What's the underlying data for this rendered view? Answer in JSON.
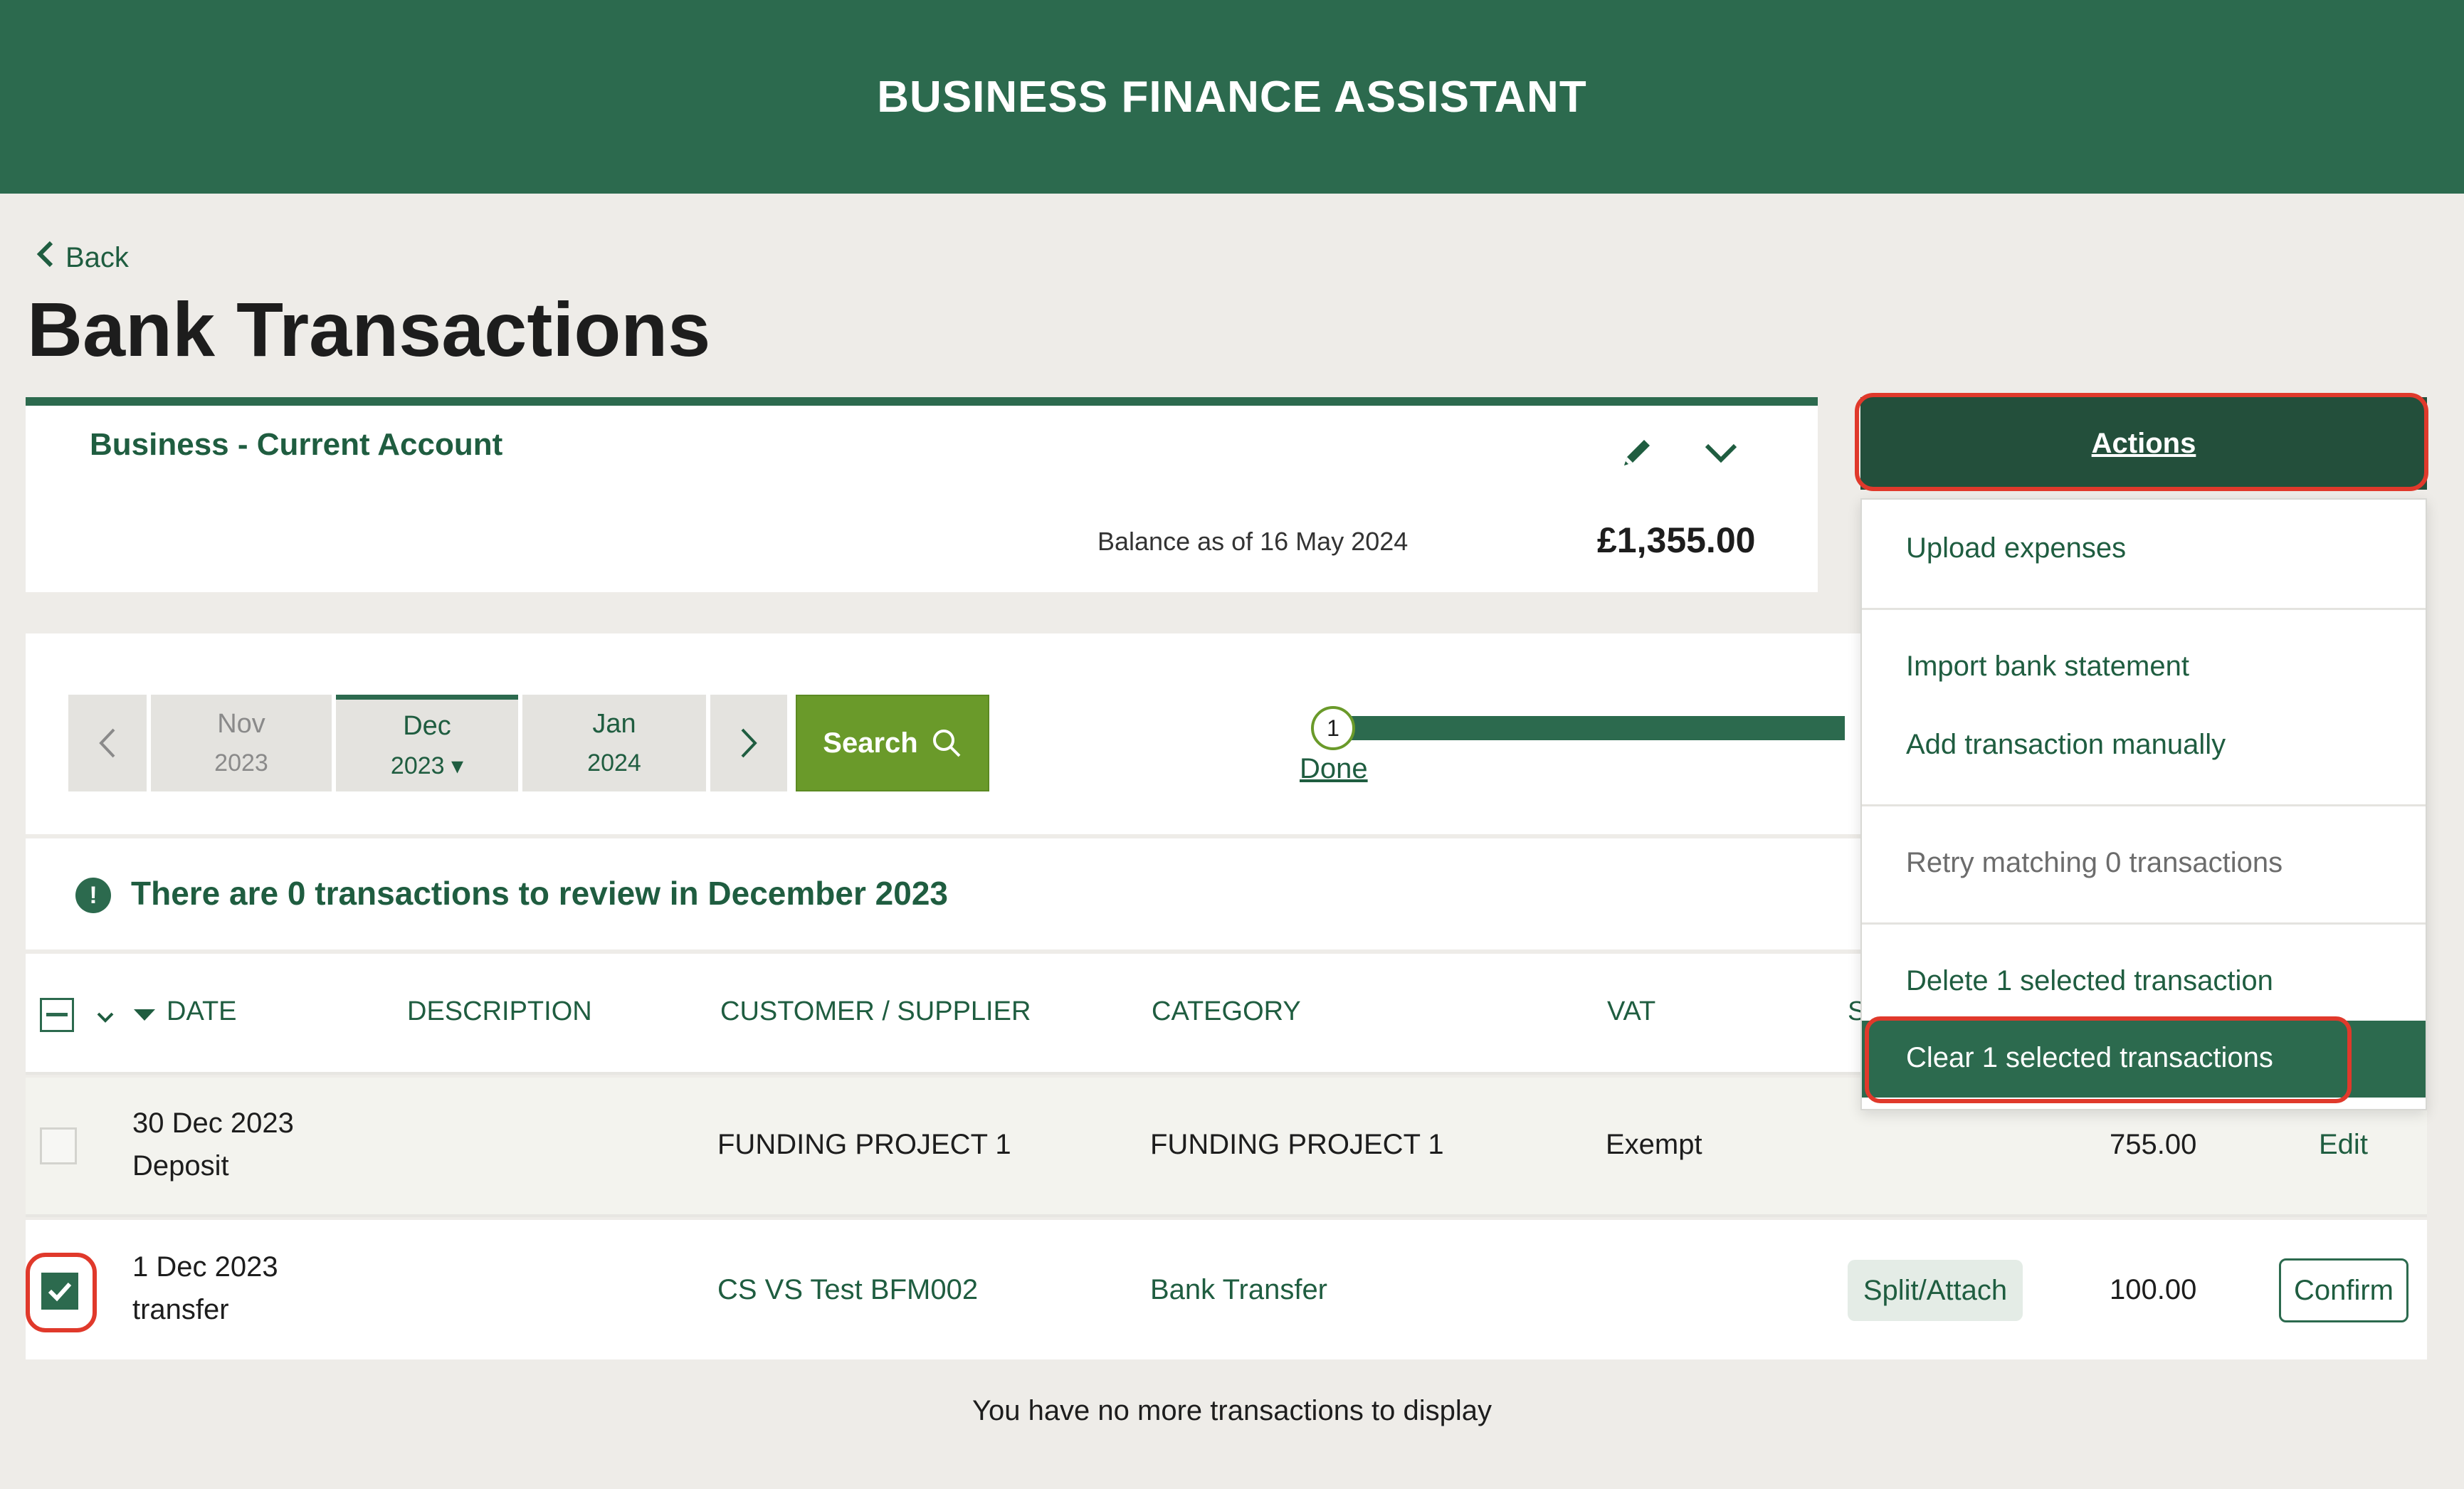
{
  "header": {
    "title": "BUSINESS FINANCE ASSISTANT"
  },
  "nav": {
    "back_label": "Back"
  },
  "page": {
    "title": "Bank Transactions"
  },
  "account": {
    "name": "Business - Current Account",
    "balance_label": "Balance as of 16 May 2024",
    "balance_value": "£1,355.00",
    "icons": [
      "pencil-icon",
      "chevron-down-icon"
    ]
  },
  "period": {
    "months": [
      {
        "month": "Nov",
        "year": "2023",
        "state": "dim"
      },
      {
        "month": "Dec",
        "year": "2023",
        "state": "active"
      },
      {
        "month": "Jan",
        "year": "2024",
        "state": "next"
      }
    ],
    "search_label": "Search"
  },
  "progress": {
    "step": "1",
    "link": "Done"
  },
  "notice": {
    "text": "There are 0 transactions to review in December 2023",
    "icon": "!"
  },
  "table": {
    "headers": {
      "date": "DATE",
      "description": "DESCRIPTION",
      "customer": "CUSTOMER / SUPPLIER",
      "category": "CATEGORY",
      "vat": "VAT",
      "s": "S"
    },
    "rows": [
      {
        "date": "30 Dec 2023",
        "type": "Deposit",
        "customer": "FUNDING PROJECT 1",
        "category": "FUNDING PROJECT 1",
        "vat": "Exempt",
        "amount": "755.00",
        "action": "Edit",
        "checked": false
      },
      {
        "date": "1 Dec 2023",
        "type": "transfer",
        "customer": "CS VS Test BFM002",
        "category": "Bank Transfer",
        "vat": "",
        "split": "Split/Attach",
        "amount": "100.00",
        "action": "Confirm",
        "checked": true
      }
    ],
    "footer": "You have no more transactions to display"
  },
  "actions": {
    "label": "Actions",
    "menu": [
      {
        "label": "Upload expenses",
        "disabled": false
      },
      {
        "label": "Import bank statement",
        "disabled": false
      },
      {
        "label": "Add transaction manually",
        "disabled": false
      },
      {
        "label": "Retry matching 0 transactions",
        "disabled": true
      },
      {
        "label": "Delete 1 selected transaction",
        "disabled": false
      },
      {
        "label": "Clear 1 selected transactions",
        "disabled": false,
        "highlighted": true
      }
    ]
  },
  "colors": {
    "brand": "#2c6a4e",
    "search": "#6a9a2a",
    "annotation": "#e0392b",
    "background": "#eeece8"
  }
}
